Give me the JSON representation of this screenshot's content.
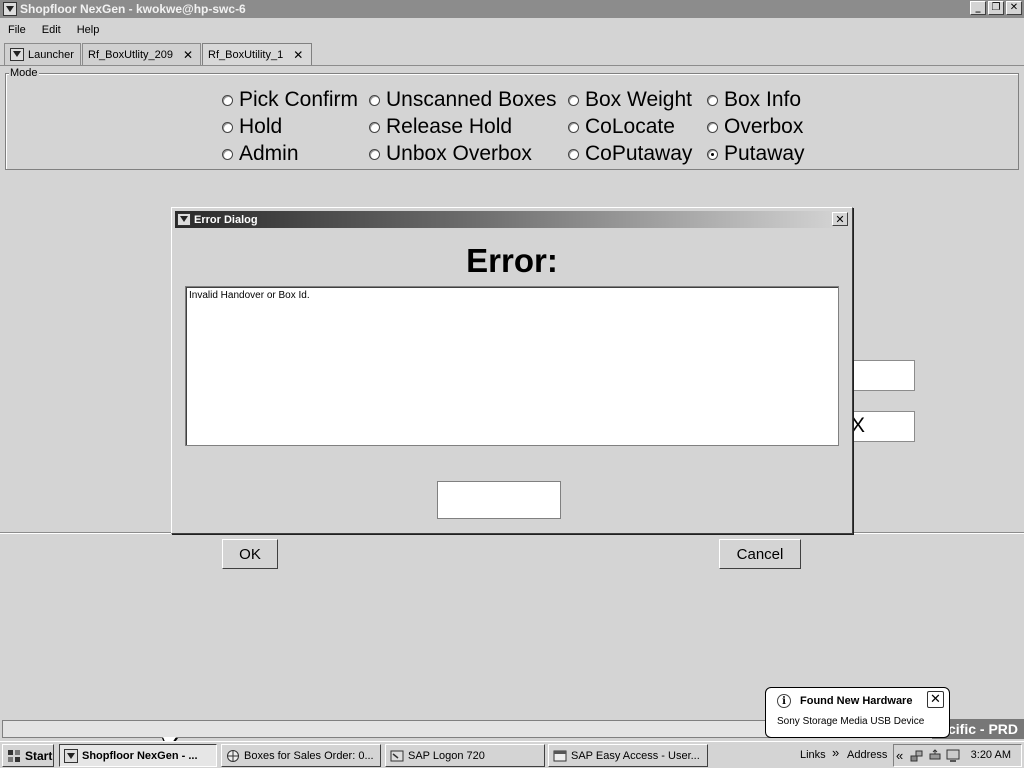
{
  "window": {
    "title": "Shopfloor NexGen  -  kwokwe@hp-swc-6",
    "min_glyph": "_",
    "max_glyph": "❐",
    "close_glyph": "✕"
  },
  "menu": [
    "File",
    "Edit",
    "Help"
  ],
  "tabs": [
    {
      "label": "Launcher",
      "icon": "app-icon"
    },
    {
      "label": "Rf_BoxUtlity_209",
      "close": "✕"
    },
    {
      "label": "Rf_BoxUtility_1",
      "close": "✕"
    }
  ],
  "mode": {
    "legend": "Mode",
    "options": [
      {
        "label": "Pick Confirm",
        "selected": false
      },
      {
        "label": "Unscanned Boxes",
        "selected": false
      },
      {
        "label": "Box Weight",
        "selected": false
      },
      {
        "label": "Box Info",
        "selected": false
      },
      {
        "label": "Hold",
        "selected": false
      },
      {
        "label": "Release Hold",
        "selected": false
      },
      {
        "label": "CoLocate",
        "selected": false
      },
      {
        "label": "Overbox",
        "selected": false
      },
      {
        "label": "Admin",
        "selected": false
      },
      {
        "label": "Unbox Overbox",
        "selected": false
      },
      {
        "label": "CoPutaway",
        "selected": false
      },
      {
        "label": "Putaway",
        "selected": true
      }
    ]
  },
  "form": {
    "field2_value_fragment": "X",
    "ok_label": "OK",
    "cancel_label": "Cancel"
  },
  "dialog": {
    "title": "Error Dialog",
    "close_glyph": "✕",
    "heading": "Error:",
    "message": "Invalid Handover or Box Id."
  },
  "statusbar": {
    "environment_fragment": "cific - PRD"
  },
  "balloon": {
    "icon_glyph": "i",
    "title": "Found New Hardware",
    "text": "Sony Storage Media USB Device",
    "close_glyph": "✕"
  },
  "taskbar": {
    "start_label": "Start",
    "buttons": [
      {
        "label": "Shopfloor NexGen  - ...",
        "active": true
      },
      {
        "label": "Boxes for Sales Order: 0...",
        "active": false
      },
      {
        "label": "SAP Logon 720",
        "active": false
      },
      {
        "label": "SAP Easy Access  - User...",
        "active": false
      }
    ],
    "links_label": "Links",
    "links_chevron": "»",
    "address_label": "Address",
    "tray_chevron": "«",
    "clock": "3:20 AM"
  },
  "colors": {
    "titlebar": "#8c8c8c",
    "dialog_title_start": "#2a2a2a",
    "face": "#d4d4d4"
  }
}
